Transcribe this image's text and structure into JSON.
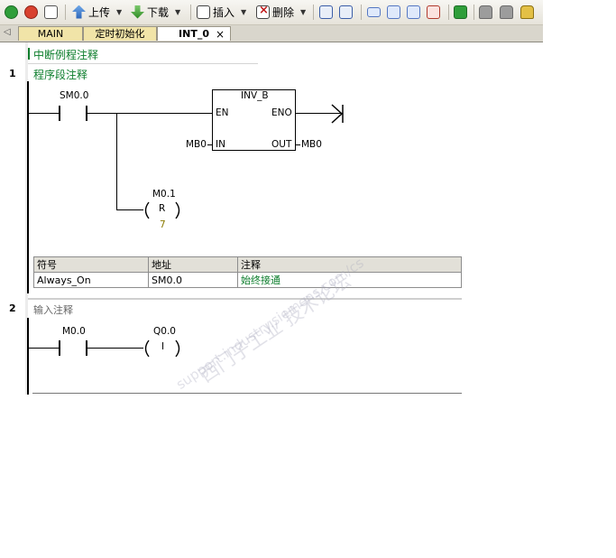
{
  "toolbar": {
    "upload_label": "上传",
    "download_label": "下载",
    "insert_label": "插入",
    "delete_label": "删除"
  },
  "tabs": [
    {
      "label": "MAIN"
    },
    {
      "label": "定时初始化"
    },
    {
      "label": "INT_0"
    }
  ],
  "tab_close_glyph": "×",
  "editor": {
    "pou_comment": "中断例程注释",
    "networks": [
      {
        "number": "1",
        "comment": "程序段注释",
        "contact_address": "SM0.0",
        "box_name": "INV_B",
        "box_en": "EN",
        "box_eno": "ENO",
        "box_in_pin": "IN",
        "box_out_pin": "OUT",
        "box_in_operand": "MB0",
        "box_out_operand": "MB0",
        "coil_address": "M0.1",
        "coil_type": "R",
        "coil_count": "7"
      },
      {
        "number": "2",
        "comment": "输入注释",
        "contact_address": "M0.0",
        "coil_address": "Q0.0",
        "coil_type": "I"
      }
    ],
    "symbol_table": {
      "headers": [
        "符号",
        "地址",
        "注释"
      ],
      "rows": [
        {
          "symbol": "Always_On",
          "address": "SM0.0",
          "comment": "始终接通"
        }
      ]
    }
  },
  "watermark": {
    "line1": "西门子工业  技术论坛",
    "line2": "support.industry.siemens.com/cs"
  },
  "colors": {
    "comment_green": "#0b7d2b",
    "tab_inactive": "#f1e4a8",
    "gutter_border": "#e4a7ad"
  }
}
